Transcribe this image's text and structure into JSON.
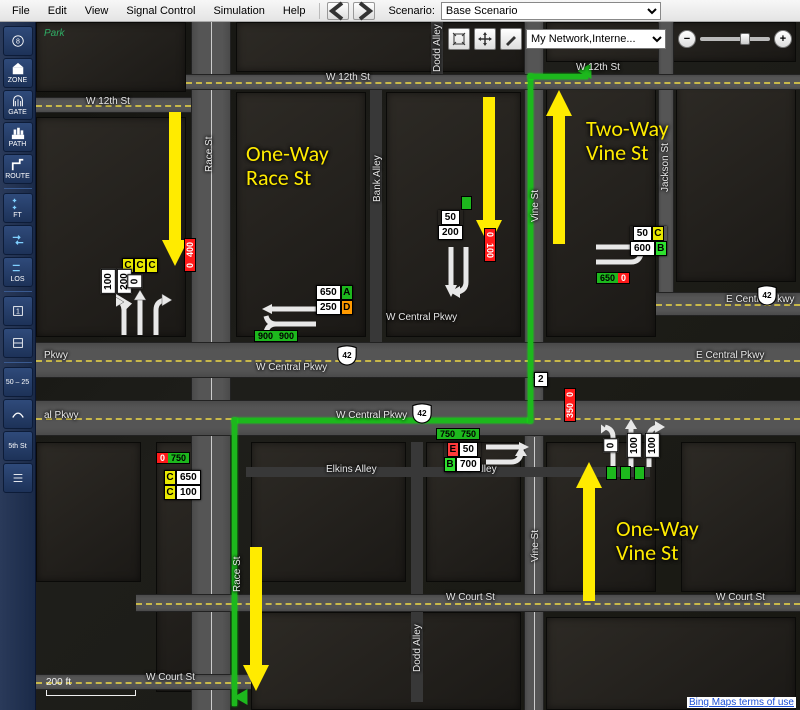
{
  "menu": {
    "items": [
      "File",
      "Edit",
      "View",
      "Signal Control",
      "Simulation",
      "Help"
    ],
    "scenario_label": "Scenario:",
    "scenario_value": "Base Scenario"
  },
  "left_tools": [
    {
      "label": "",
      "icon": "intersection"
    },
    {
      "label": "ZONE",
      "icon": "zone"
    },
    {
      "label": "GATE",
      "icon": "gate"
    },
    {
      "label": "PATH",
      "icon": "path"
    },
    {
      "label": "ROUTE",
      "icon": "route"
    },
    {
      "label": "",
      "icon": "divider"
    },
    {
      "label": "FT",
      "icon": "ft"
    },
    {
      "label": "",
      "icon": "arrows"
    },
    {
      "label": "LOS",
      "icon": "los"
    },
    {
      "label": "",
      "icon": "divider"
    },
    {
      "label": "",
      "icon": "box1"
    },
    {
      "label": "",
      "icon": "box2"
    },
    {
      "label": "",
      "icon": "divider"
    },
    {
      "label": "",
      "icon": "range"
    },
    {
      "label": "",
      "icon": "curve"
    },
    {
      "label": "5th St",
      "icon": "street"
    },
    {
      "label": "",
      "icon": "list"
    }
  ],
  "map_controls": {
    "layer_select": "My Network,Interne..."
  },
  "annotations": {
    "race": "One-Way\nRace St",
    "two_vine": "Two-Way\nVine St",
    "one_vine": "One-Way\nVine St"
  },
  "streets": {
    "w12": "W 12th St",
    "race": "Race St",
    "bank": "Bank Alley",
    "dodd": "Dodd Alley",
    "vine": "Vine St",
    "jackson": "Jackson St",
    "wcentral": "W Central Pkwy",
    "ecentral": "E Central Pkwy",
    "elkins": "Elkins Alley",
    "wcourt": "W Court St",
    "park": "Park"
  },
  "route_shield": "42",
  "volumes": {
    "race_nb": [
      {
        "v": "0",
        "g": "C"
      },
      {
        "v": "0",
        "g": "C"
      },
      {
        "v": "100",
        "g": "C"
      }
    ],
    "race_sb": [
      {
        "v": "100",
        "g": ""
      },
      {
        "v": "200",
        "g": ""
      },
      {
        "v": "0",
        "g": ""
      }
    ],
    "race_red": {
      "g": "0",
      "r": "400"
    },
    "wcp_wb": [
      {
        "v": "650",
        "g": "A"
      },
      {
        "v": "250",
        "g": "D"
      }
    ],
    "wcp_sig": {
      "g": "900",
      "r": "900"
    },
    "vine_top": [
      {
        "v": "50",
        "g": ""
      },
      {
        "v": "200",
        "g": ""
      }
    ],
    "vine_top_red": {
      "r": "100",
      "g": "0"
    },
    "ecp_nb": [
      {
        "v": "50",
        "g": "C"
      },
      {
        "v": "600",
        "g": "B"
      }
    ],
    "ecp_sig": {
      "g": "650",
      "r": "0"
    },
    "race_s_left": {
      "g": "0",
      "r": "750"
    },
    "race_s_vol": [
      {
        "v": "650",
        "g": "C"
      },
      {
        "v": "100",
        "g": "C"
      }
    ],
    "vine_s_left": [
      {
        "v": "50",
        "g": "E"
      },
      {
        "v": "700",
        "g": "B"
      }
    ],
    "vine_s_sig": {
      "g": "750",
      "r": "750"
    },
    "vine_s_right": [
      {
        "v": "0",
        "g": ""
      },
      {
        "v": "100",
        "g": ""
      },
      {
        "v": "100",
        "g": ""
      }
    ],
    "vine_s_red": {
      "r": "350",
      "g": "0"
    },
    "node2": "2"
  },
  "scale": "200 ft",
  "terms": "Bing Maps terms of use",
  "range_label": "50 – 25"
}
